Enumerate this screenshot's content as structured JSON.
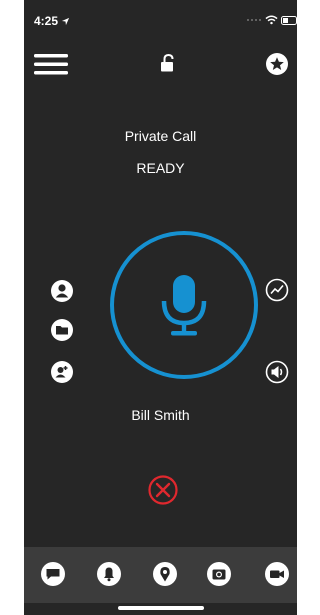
{
  "status_bar": {
    "time": "4:25"
  },
  "call": {
    "type": "Private Call",
    "state": "READY",
    "contact_name": "Bill Smith"
  },
  "colors": {
    "accent": "#1691d1",
    "danger": "#e0282e",
    "background": "#262626",
    "bottom_bar": "#3c3c3c"
  },
  "icons": {
    "top": [
      "menu-icon",
      "unlock-icon",
      "star-icon"
    ],
    "left": [
      "contact-icon",
      "folder-icon",
      "add-contact-icon"
    ],
    "right": [
      "activity-icon",
      "speaker-icon"
    ],
    "bottom": [
      "chat-icon",
      "alert-icon",
      "location-icon",
      "camera-icon",
      "video-icon"
    ]
  }
}
